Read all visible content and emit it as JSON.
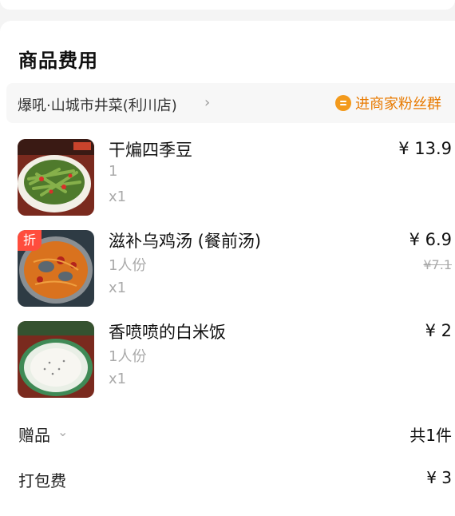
{
  "section": {
    "title": "商品费用"
  },
  "store": {
    "name": "爆吼·山城市井菜(利川店)",
    "fans_label": "进商家粉丝群"
  },
  "items": [
    {
      "name": "干煸四季豆",
      "spec": "1",
      "qty": "x1",
      "price": "¥ 13.9",
      "original_price": "",
      "badge": ""
    },
    {
      "name": "滋补乌鸡汤 (餐前汤)",
      "spec": "1人份",
      "qty": "x1",
      "price": "¥ 6.9",
      "original_price": "¥7.1",
      "badge": "折"
    },
    {
      "name": "香喷喷的白米饭",
      "spec": "1人份",
      "qty": "x1",
      "price": "¥ 2",
      "original_price": "",
      "badge": ""
    }
  ],
  "gift": {
    "label": "赠品",
    "value": "共1件"
  },
  "packing": {
    "label": "打包费",
    "value": "¥ 3"
  },
  "colors": {
    "accent": "#e87a00",
    "discount_badge": "#ff4d3d"
  }
}
